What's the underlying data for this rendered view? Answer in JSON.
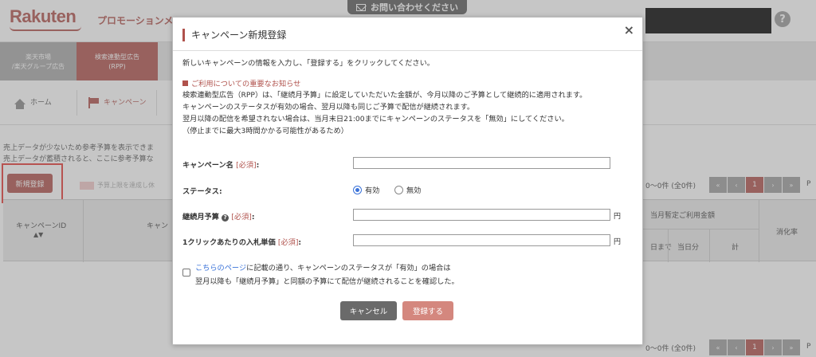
{
  "header": {
    "logo_text": "Rakuten",
    "brand_text": "プロモーションメ",
    "contact_label": "お問い合わせください",
    "help_label": "?"
  },
  "nav": {
    "items": [
      {
        "label": "楽天市場\n/楽天グループ広告"
      },
      {
        "label": "検索連動型広告\n(RPP)"
      }
    ]
  },
  "subnav": {
    "home_label": "ホーム",
    "campaign_label": "キャンペーン"
  },
  "page": {
    "info_line1": "売上データが少ないため参考予算を表示できま",
    "info_line2": "売上データが蓄積されると、ここに参考予算な",
    "new_button": "新規登録",
    "budget_legend": "予算上限を達成し休",
    "table": {
      "col_campaign_id": "キャンペーンID",
      "col_campaign_name": "キャン",
      "col_monthly_amount": "当月暫定ご利用金額",
      "col_until": "日まで",
      "col_today": "当日分",
      "col_total": "計",
      "col_consumption": "消化率",
      "sort_arrows": "▲▼"
    },
    "pager": {
      "count_text": "0〜0件 (全0件)",
      "first": "«",
      "prev": "‹",
      "current": "1",
      "next": "›",
      "last": "»",
      "trailing": "P"
    }
  },
  "modal": {
    "title": "キャンペーン新規登録",
    "close": "×",
    "intro": "新しいキャンペーンの情報を入力し、「登録する」をクリックしてください。",
    "notice_heading": "ご利用についての重要なお知らせ",
    "notice_lines": [
      "検索連動型広告（RPP）は、「継続月予算」に設定していただいた金額が、今月以降のご予算として継続的に適用されます。",
      "キャンペーンのステータスが有効の場合、翌月以降も同じご予算で配信が継続されます。",
      "翌月以降の配信を希望されない場合は、当月末日21:00までにキャンペーンのステータスを「無効」にしてください。",
      "（停止までに最大3時間かかる可能性があるため）"
    ],
    "fields": {
      "name_label": "キャンペーン名",
      "required": "[必須]",
      "colon": ":",
      "name_value": "",
      "status_label": "ステータス",
      "status_options": [
        "有効",
        "無効"
      ],
      "status_selected": "有効",
      "budget_label": "継続月予算",
      "budget_value": "",
      "bid_label": "1クリックあたりの入札単価",
      "bid_value": "",
      "unit": "円"
    },
    "confirm": {
      "link": "こちらのページ",
      "line1_rest": "に記載の通り、キャンペーンのステータスが「有効」の場合は",
      "line2": "翌月以降も「継続月予算」と同額の予算にて配信が継続されることを確認した。",
      "checked": false
    },
    "buttons": {
      "cancel": "キャンセル",
      "submit": "登録する"
    }
  },
  "colors": {
    "brand": "#b0524c",
    "submit_disabled": "#d4877e",
    "cancel": "#6a6a6a",
    "link": "#3b73d9"
  }
}
